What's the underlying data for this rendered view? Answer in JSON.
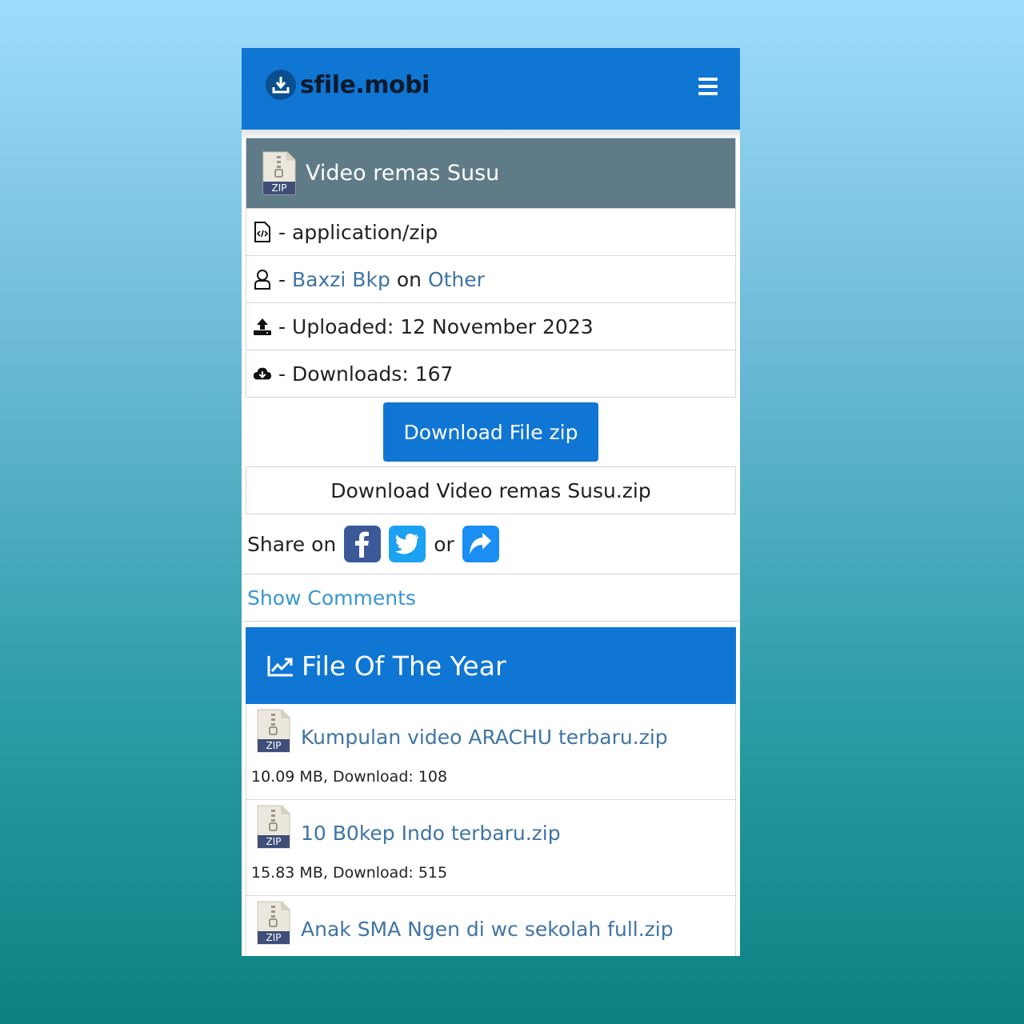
{
  "header": {
    "logo_text": "sfile.mobi",
    "brand_color": "#1076d4"
  },
  "file": {
    "title": "Video remas Susu",
    "icon_label": "ZIP",
    "type": "application/zip",
    "uploader": "Baxzi Bkp",
    "on_word": "on",
    "category": "Other",
    "uploaded": "Uploaded: 12 November 2023",
    "downloads": "Downloads: 167",
    "sep": "-"
  },
  "download": {
    "button_label": "Download File zip",
    "filename_label": "Download Video remas Susu.zip"
  },
  "share": {
    "prefix": "Share on",
    "or_word": "or"
  },
  "comments": {
    "label": "Show Comments"
  },
  "file_of_the_year": {
    "title": "File Of The Year",
    "items": [
      {
        "name": "Kumpulan video ARACHU terbaru.zip",
        "meta": "10.09 MB, Download: 108",
        "icon_label": "ZIP"
      },
      {
        "name": "10 B0kep Indo terbaru.zip",
        "meta": "15.83 MB, Download: 515",
        "icon_label": "ZIP"
      },
      {
        "name": "Anak SMA Ngen di wc sekolah full.zip",
        "meta": "",
        "icon_label": "ZIP"
      }
    ]
  }
}
